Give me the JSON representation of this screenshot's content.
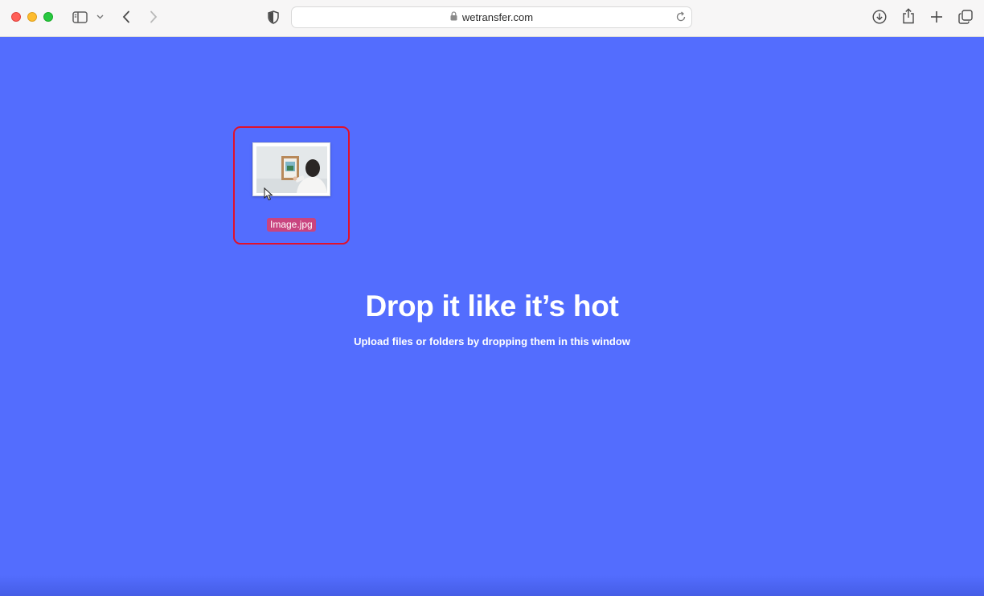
{
  "browser": {
    "url": "wetransfer.com",
    "icons": {
      "sidebar": "sidebar-icon",
      "sidebar_menu": "chevron-down-icon",
      "back": "chevron-left-icon",
      "forward": "chevron-right-icon",
      "privacy": "shield-icon",
      "lock": "lock-icon",
      "reload": "reload-icon",
      "downloads": "download-icon",
      "share": "share-icon",
      "new_tab": "plus-icon",
      "tabs_overview": "tabs-icon"
    }
  },
  "drop_zone": {
    "headline": "Drop it like it’s hot",
    "subtitle": "Upload files or folders by dropping them in this window",
    "background_color": "#536dfe"
  },
  "dragged_file": {
    "name": "Image.jpg",
    "highlight_color": "#e0112b"
  }
}
